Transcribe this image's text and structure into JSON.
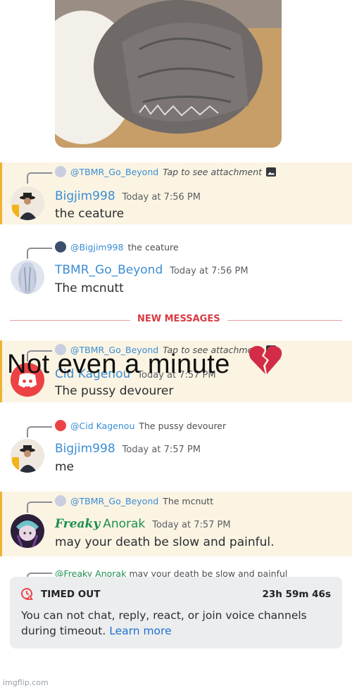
{
  "messages": [
    {
      "reply_to_name": "@TBMR_Go_Beyond",
      "reply_to_text": "Tap to see attachment",
      "author": "Bigjim998",
      "time": "Today at 7:56 PM",
      "text": "the ceature"
    },
    {
      "reply_to_name": "@Bigjim998",
      "reply_to_text": "the ceature",
      "author": "TBMR_Go_Beyond",
      "time": "Today at 7:56 PM",
      "text": "The mcnutt"
    },
    {
      "reply_to_name": "@TBMR_Go_Beyond",
      "reply_to_text": "Tap to see attachment",
      "author": "Cid Kagenou",
      "time": "Today at 7:57 PM",
      "text": "The pussy devourer"
    },
    {
      "reply_to_name": "@Cid Kagenou",
      "reply_to_text": "The pussy devourer",
      "author": "Bigjim998",
      "time": "Today at 7:57 PM",
      "text": "me"
    },
    {
      "reply_to_name": "@TBMR_Go_Beyond",
      "reply_to_text": "The mcnutt",
      "author_prefix": "Freaky",
      "author": "Anorak",
      "time": "Today at 7:57 PM",
      "text": "may your death be slow and painful."
    }
  ],
  "partial_reply": {
    "name": "@Freaky Anorak",
    "text": "may your death be slow and painful"
  },
  "divider": {
    "label": "NEW MESSAGES"
  },
  "caption": {
    "text": "Not even a minute"
  },
  "timeout": {
    "title": "TIMED OUT",
    "timer": "23h 59m 46s",
    "description": "You can not chat, reply, react, or join voice channels during timeout.",
    "link": "Learn more"
  },
  "watermark": "imgflip.com",
  "icons": {
    "image_attachment": "image-icon",
    "discord_logo": "discord-icon",
    "timeout": "timeout-clock-icon",
    "caption_emoji": "broken-heart-icon"
  },
  "colors": {
    "mention_bg": "#fbf4e3",
    "mention_bar": "#f0b132",
    "username_blue": "#3b8dd4",
    "username_green": "#1e8f4e",
    "new_messages_red": "#d93c43",
    "discord_red": "#ed4245",
    "link_blue": "#1f6fd1"
  }
}
